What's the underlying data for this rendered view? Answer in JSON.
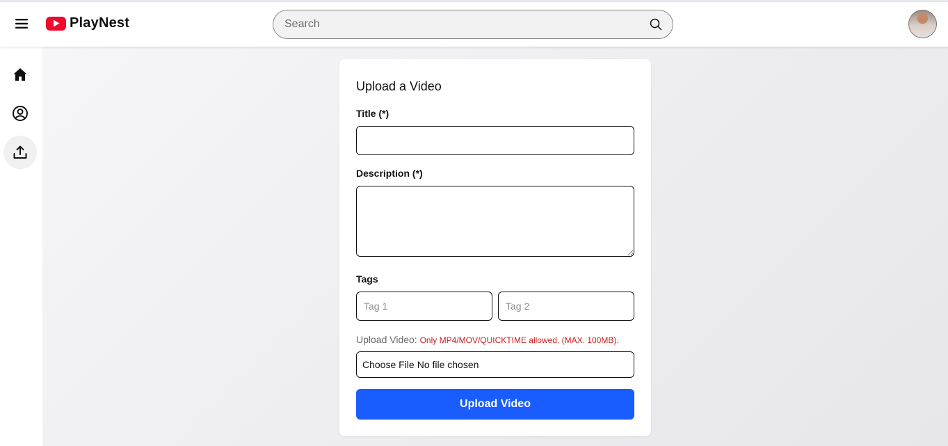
{
  "app": {
    "name": "PlayNest",
    "brand_color": "#f00a2e",
    "accent_color": "#1a5dff"
  },
  "header": {
    "menu_icon": "hamburger-menu-icon",
    "search": {
      "placeholder": "Search",
      "value": "",
      "icon": "search-icon"
    },
    "avatar_icon": "user-avatar"
  },
  "sidebar": {
    "items": [
      {
        "id": "home",
        "icon": "home-icon",
        "active": false
      },
      {
        "id": "profile",
        "icon": "user-circle-icon",
        "active": false
      },
      {
        "id": "upload",
        "icon": "upload-icon",
        "active": true
      }
    ]
  },
  "form": {
    "title": "Upload a Video",
    "title_label": "Title (*)",
    "title_value": "",
    "description_label": "Description (*)",
    "description_value": "",
    "tags_label": "Tags",
    "tag1_placeholder": "Tag 1",
    "tag2_placeholder": "Tag 2",
    "upload_label": "Upload Video:",
    "upload_restriction": "Only MP4/MOV/QUICKTIME allowed. (MAX. 100MB).",
    "file_button": "Choose File",
    "file_status": "No file chosen",
    "submit_label": "Upload Video",
    "warning_color": "#cc1a1a"
  }
}
